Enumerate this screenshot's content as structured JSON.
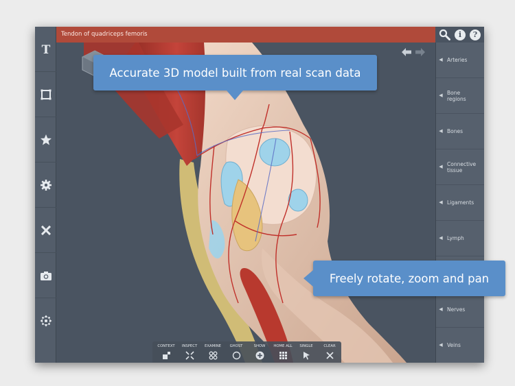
{
  "title_bar": {
    "text": "Tendon of quadriceps femoris"
  },
  "top_icons": [
    {
      "name": "search-icon"
    },
    {
      "name": "info-icon"
    },
    {
      "name": "help-icon"
    }
  ],
  "left_tools": [
    {
      "name": "text-icon"
    },
    {
      "name": "frame-icon"
    },
    {
      "name": "star-icon"
    },
    {
      "name": "gear-icon"
    },
    {
      "name": "pencil-ruler-icon"
    },
    {
      "name": "camera-icon"
    },
    {
      "name": "move-arrows-icon"
    }
  ],
  "layers": [
    {
      "label": "Arteries"
    },
    {
      "label": "Bone\nregions"
    },
    {
      "label": "Bones"
    },
    {
      "label": "Connective\ntissue"
    },
    {
      "label": "Ligaments"
    },
    {
      "label": "Lymph"
    },
    {
      "label": ""
    },
    {
      "label": "Nerves"
    },
    {
      "label": "Veins"
    }
  ],
  "callouts": {
    "top": "Accurate 3D model built from real scan data",
    "bottom": "Freely rotate, zoom and pan"
  },
  "bottom_toolbar": [
    {
      "label": "CONTEXT",
      "icon": "context-icon"
    },
    {
      "label": "INSPECT",
      "icon": "inspect-icon"
    },
    {
      "label": "EXAMINE",
      "icon": "examine-icon"
    },
    {
      "label": "GHOST",
      "icon": "ghost-icon"
    },
    {
      "label": "SHOW",
      "icon": "show-plus-icon"
    },
    {
      "label": "HOME ALL",
      "icon": "home-all-icon"
    },
    {
      "label": "SINGLE",
      "icon": "single-cursor-icon"
    },
    {
      "label": "CLEAR",
      "icon": "clear-icon"
    }
  ],
  "colors": {
    "title_bar": "#b04a3a",
    "panel": "#4a5461",
    "callout": "#5a8fc9"
  }
}
